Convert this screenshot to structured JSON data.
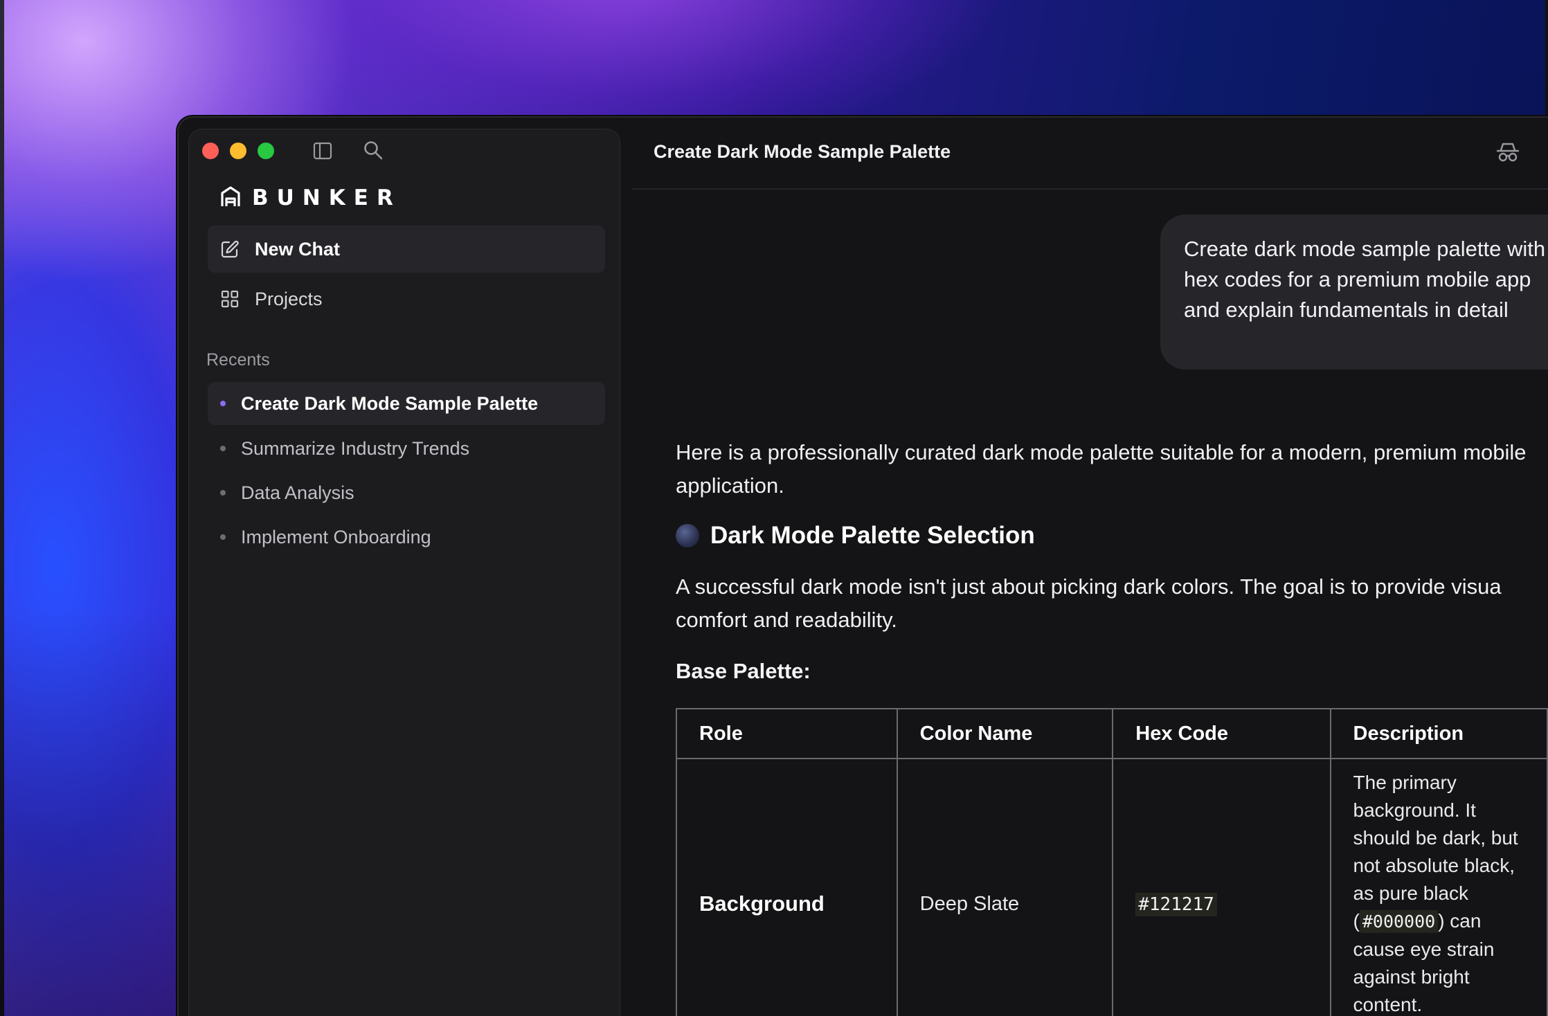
{
  "app": {
    "name": "BUNKER",
    "conversation_title": "Create Dark Mode Sample Palette"
  },
  "sidebar": {
    "new_chat_label": "New Chat",
    "projects_label": "Projects",
    "recents_label": "Recents",
    "recents": [
      {
        "label": "Create Dark Mode Sample Palette",
        "active": true
      },
      {
        "label": "Summarize Industry Trends",
        "active": false
      },
      {
        "label": "Data Analysis",
        "active": false
      },
      {
        "label": "Implement Onboarding",
        "active": false
      }
    ]
  },
  "chat": {
    "user_message": "Create dark mode sample palette with hex codes for a premium mobile app and explain fundamentals in detail",
    "response": {
      "intro": "Here is a professionally curated dark mode palette suitable for a modern, premium mobile application.",
      "heading": "Dark Mode Palette Selection",
      "paragraph_line1": "A successful dark mode isn't just about picking dark colors. The goal is to provide visua",
      "paragraph_line2": "comfort and readability.",
      "base_label": "Base Palette:",
      "table": {
        "headers": [
          "Role",
          "Color Name",
          "Hex Code",
          "Description"
        ],
        "rows": [
          {
            "role": "Background",
            "color_name": "Deep Slate",
            "hex": "#121217",
            "description_before": "The primary background. It should be dark, but not absolute black, as pure black (",
            "description_code": "#000000",
            "description_after": ") can cause eye strain against bright content."
          }
        ]
      }
    }
  },
  "icons": {
    "sidebar_toggle": "sidebar-toggle-icon",
    "search": "search-icon",
    "logo": "bunker-logo-icon",
    "new_chat": "compose-icon",
    "projects": "grid-icon",
    "incognito": "incognito-icon",
    "heading_emoji": "moon-icon"
  },
  "colors": {
    "window_bg": "#141416",
    "sidebar_bg": "#1c1c1f",
    "active_item_bg": "#26262a",
    "accent_dot": "#8d6cf5",
    "traffic_red": "#fe5f57",
    "traffic_yellow": "#febc2e",
    "traffic_green": "#28c840"
  }
}
